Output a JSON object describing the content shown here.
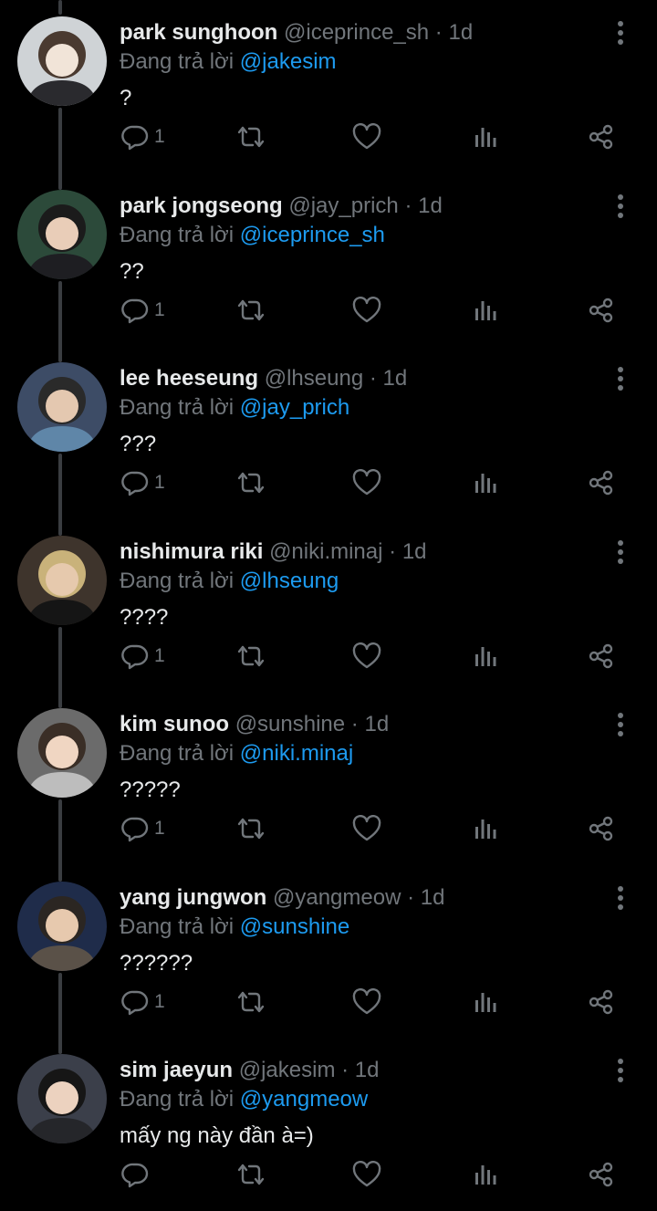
{
  "reply_prefix": "Đang trả lời",
  "icons": {
    "reply": "reply-icon",
    "retweet": "retweet-icon",
    "like": "heart-icon",
    "views": "views-icon",
    "share": "share-icon",
    "more": "more-vertical-icon"
  },
  "colors": {
    "background": "#000000",
    "mention": "#1d9bf0",
    "secondary_text": "#71767b",
    "icon": "#71767b",
    "thread_line": "#3a3d41"
  },
  "tweets": [
    {
      "name": "park sunghoon",
      "handle": "@iceprince_sh",
      "time": "1d",
      "replying_to": "@jakesim",
      "text": "?",
      "reply_count": "1"
    },
    {
      "name": "park jongseong",
      "handle": "@jay_prich",
      "time": "1d",
      "replying_to": "@iceprince_sh",
      "text": "??",
      "reply_count": "1"
    },
    {
      "name": "lee heeseung",
      "handle": "@lhseung",
      "time": "1d",
      "replying_to": "@jay_prich",
      "text": "???",
      "reply_count": "1"
    },
    {
      "name": "nishimura riki",
      "handle": "@niki.minaj",
      "time": "1d",
      "replying_to": "@lhseung",
      "text": "????",
      "reply_count": "1"
    },
    {
      "name": "kim sunoo",
      "handle": "@sunshine",
      "time": "1d",
      "replying_to": "@niki.minaj",
      "text": "?????",
      "reply_count": "1"
    },
    {
      "name": "yang jungwon",
      "handle": "@yangmeow",
      "time": "1d",
      "replying_to": "@sunshine",
      "text": "??????",
      "reply_count": "1"
    },
    {
      "name": "sim jaeyun",
      "handle": "@jakesim",
      "time": "1d",
      "replying_to": "@yangmeow",
      "text": "mấy ng này đần à=)",
      "reply_count": ""
    }
  ]
}
